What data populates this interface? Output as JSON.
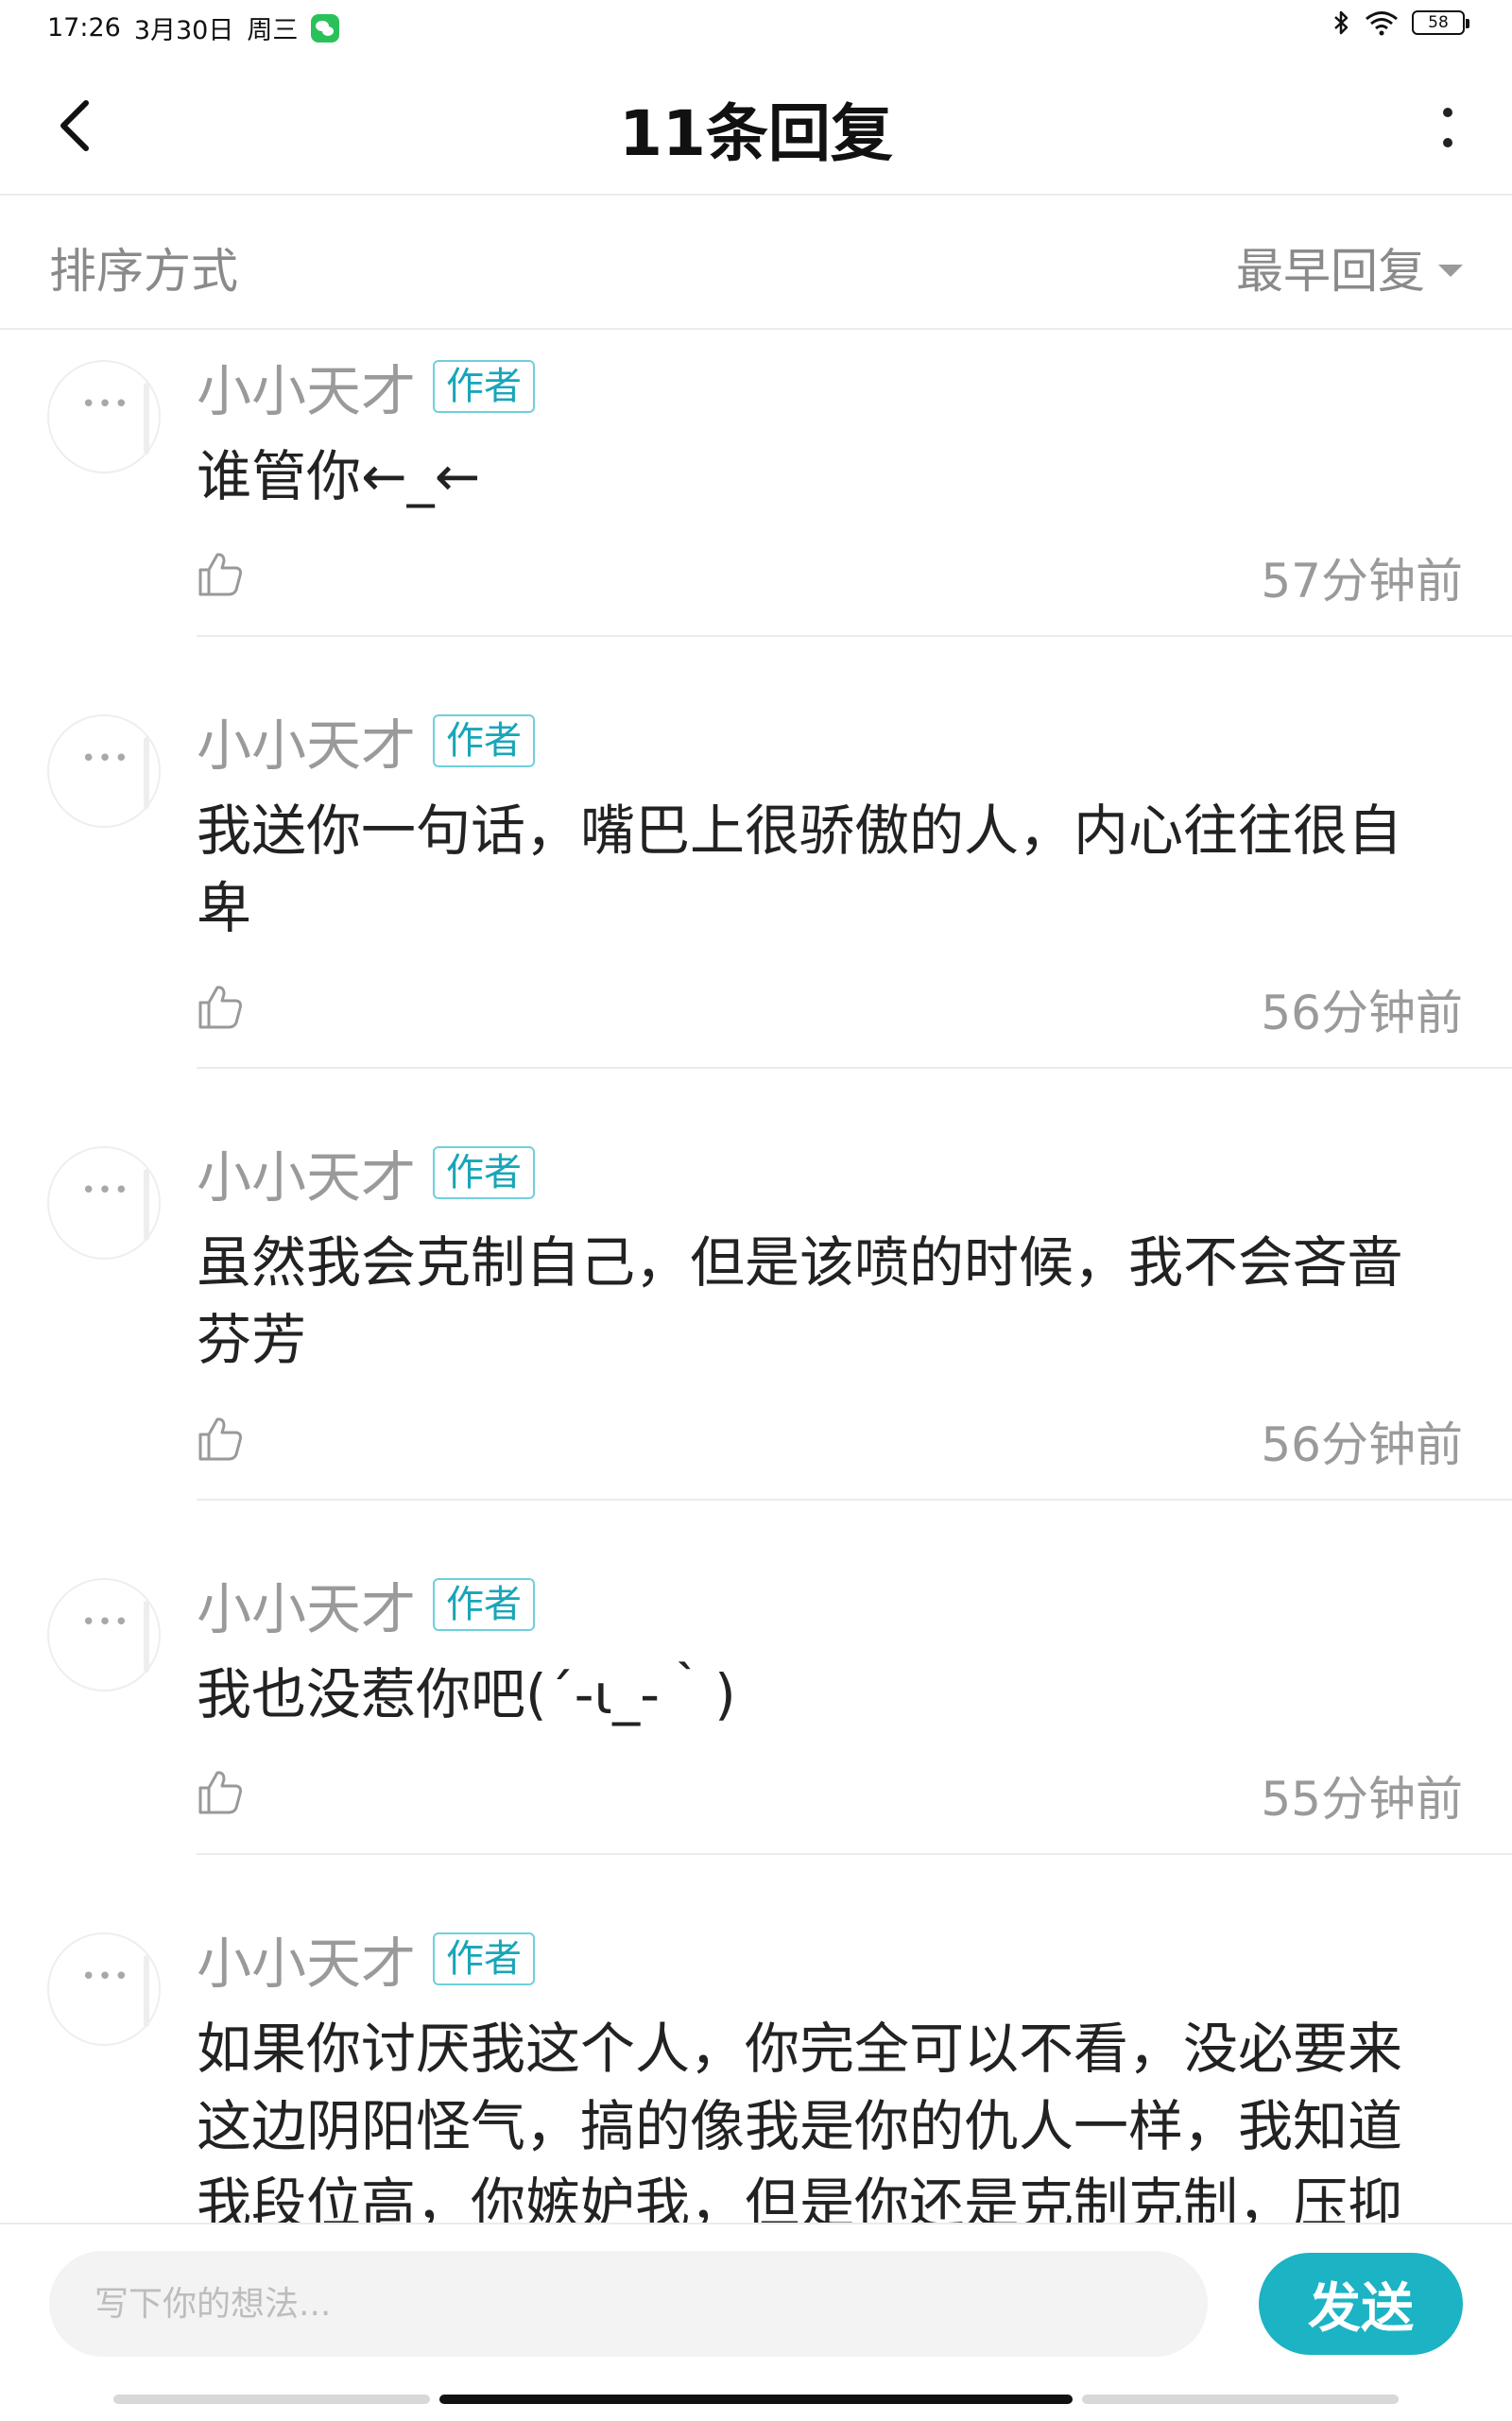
{
  "status_bar": {
    "time": "17:26",
    "date": "3月30日",
    "weekday": "周三",
    "battery": "58",
    "icons": [
      "wechat-icon",
      "bluetooth-icon",
      "wifi-icon",
      "battery-icon"
    ]
  },
  "header": {
    "title": "11条回复",
    "back_icon": "chevron-left-icon",
    "more_icon": "vertical-dots-icon"
  },
  "sort": {
    "label": "排序方式",
    "selected": "最早回复"
  },
  "replies": [
    {
      "username": "小小天才",
      "tag": "作者",
      "content": "谁管你←_←",
      "time": "57分钟前"
    },
    {
      "username": "小小天才",
      "tag": "作者",
      "content": "我送你一句话，嘴巴上很骄傲的人，内心往往很自卑",
      "time": "56分钟前"
    },
    {
      "username": "小小天才",
      "tag": "作者",
      "content": "虽然我会克制自己，但是该喷的时候，我不会吝啬芬芳",
      "time": "56分钟前"
    },
    {
      "username": "小小天才",
      "tag": "作者",
      "content": "我也没惹你吧(´-ι_-｀)",
      "time": "55分钟前"
    },
    {
      "username": "小小天才",
      "tag": "作者",
      "content": "如果你讨厌我这个人，你完全可以不看，没必要来这边阴阳怪气，搞的像我是你的仇人一样，我知道我段位高，你嫉妒我，但是你还是克制克制，压抑",
      "time": ""
    }
  ],
  "composer": {
    "placeholder": "写下你的想法...",
    "send_label": "发送"
  },
  "colors": {
    "accent": "#1cb3c4",
    "tag_text": "#18a6b8",
    "muted_text": "#9a9a9a",
    "divider": "#ececec"
  }
}
